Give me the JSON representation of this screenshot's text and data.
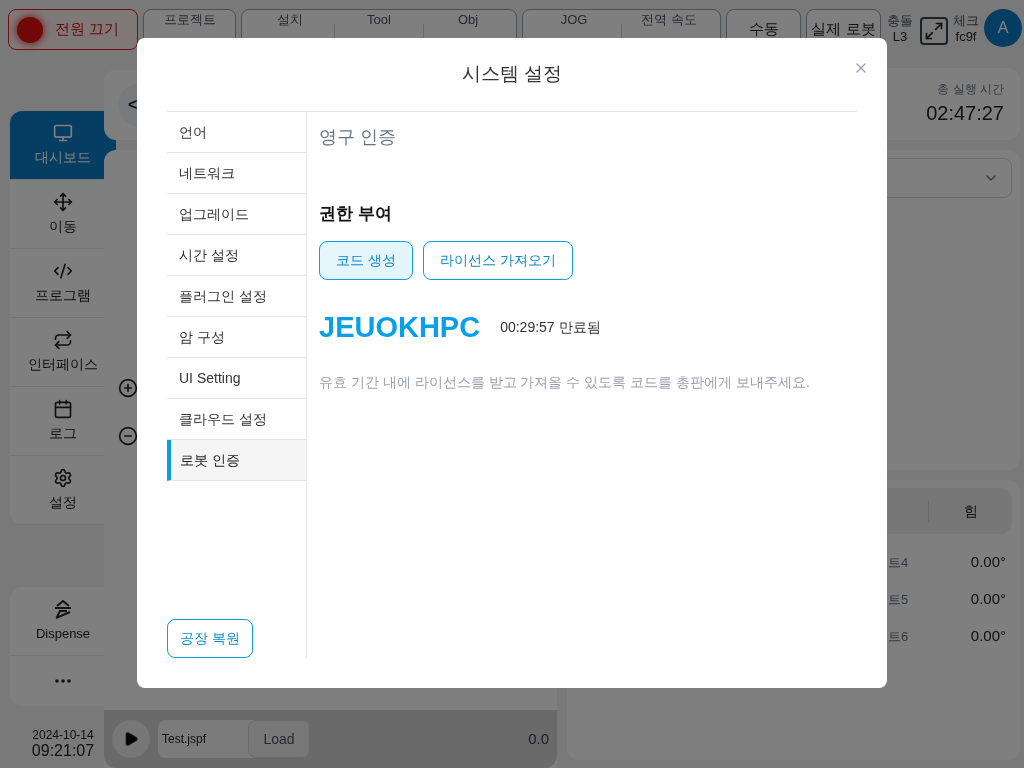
{
  "top_bar": {
    "power_button": {
      "label": "전원 끄기",
      "on": true
    },
    "groups": [
      {
        "fields": [
          {
            "label": "프로젝트"
          }
        ]
      },
      {
        "fields": [
          {
            "label": "설치"
          },
          {
            "label": "Tool"
          },
          {
            "label": "Obj"
          }
        ]
      },
      {
        "fields": [
          {
            "label": "JOG"
          },
          {
            "label": "전역 속도"
          }
        ]
      }
    ],
    "mode_buttons": [
      "수동",
      "실제 로봇"
    ],
    "collision": {
      "label": "충돌",
      "value": "L3"
    },
    "check": {
      "label": "체크",
      "value": "fc9f"
    },
    "avatar": "A"
  },
  "sidebar": {
    "items": [
      {
        "label": "대시보드",
        "selected": true
      },
      {
        "label": "이동",
        "selected": false
      },
      {
        "label": "프로그램",
        "selected": false
      },
      {
        "label": "인터페이스",
        "selected": false
      },
      {
        "label": "로그",
        "selected": false
      },
      {
        "label": "설정",
        "selected": false
      }
    ],
    "plugin": {
      "label": "Dispense"
    },
    "date": "2024-10-14",
    "time": "09:21:07"
  },
  "main": {
    "back": "<",
    "program_file": "Test.jspf",
    "load_button": "Load",
    "progress_value": "0.0"
  },
  "right_panel": {
    "run_time_label": "총 실행 시간",
    "run_time": "02:47:27",
    "tab": "힘",
    "rows": [
      {
        "label": "트4",
        "value": "0.00°"
      },
      {
        "label": "트5",
        "value": "0.00°"
      },
      {
        "label": "트6",
        "value": "0.00°"
      }
    ]
  },
  "dialog": {
    "title": "시스템 설정",
    "nav": [
      {
        "label": "언어",
        "selected": false
      },
      {
        "label": "네트워크",
        "selected": false
      },
      {
        "label": "업그레이드",
        "selected": false
      },
      {
        "label": "시간 설정",
        "selected": false
      },
      {
        "label": "플러그인 설정",
        "selected": false
      },
      {
        "label": "암 구성",
        "selected": false
      },
      {
        "label": "UI Setting",
        "selected": false
      },
      {
        "label": "클라우드 설정",
        "selected": false
      },
      {
        "label": "로봇 인증",
        "selected": true
      }
    ],
    "reset_button": "공장 복원",
    "section_title": "영구 인증",
    "subtitle": "권한 부여",
    "buttons": [
      {
        "label": "코드 생성",
        "selected": true
      },
      {
        "label": "라이선스 가져오기",
        "selected": false
      }
    ],
    "code": "JEUOKHPC",
    "expiry": "00:29:57 만료됨",
    "hint": "유효 기간 내에 라이선스를 받고 가져올 수 있도록 코드를 총판에게 보내주세요."
  }
}
